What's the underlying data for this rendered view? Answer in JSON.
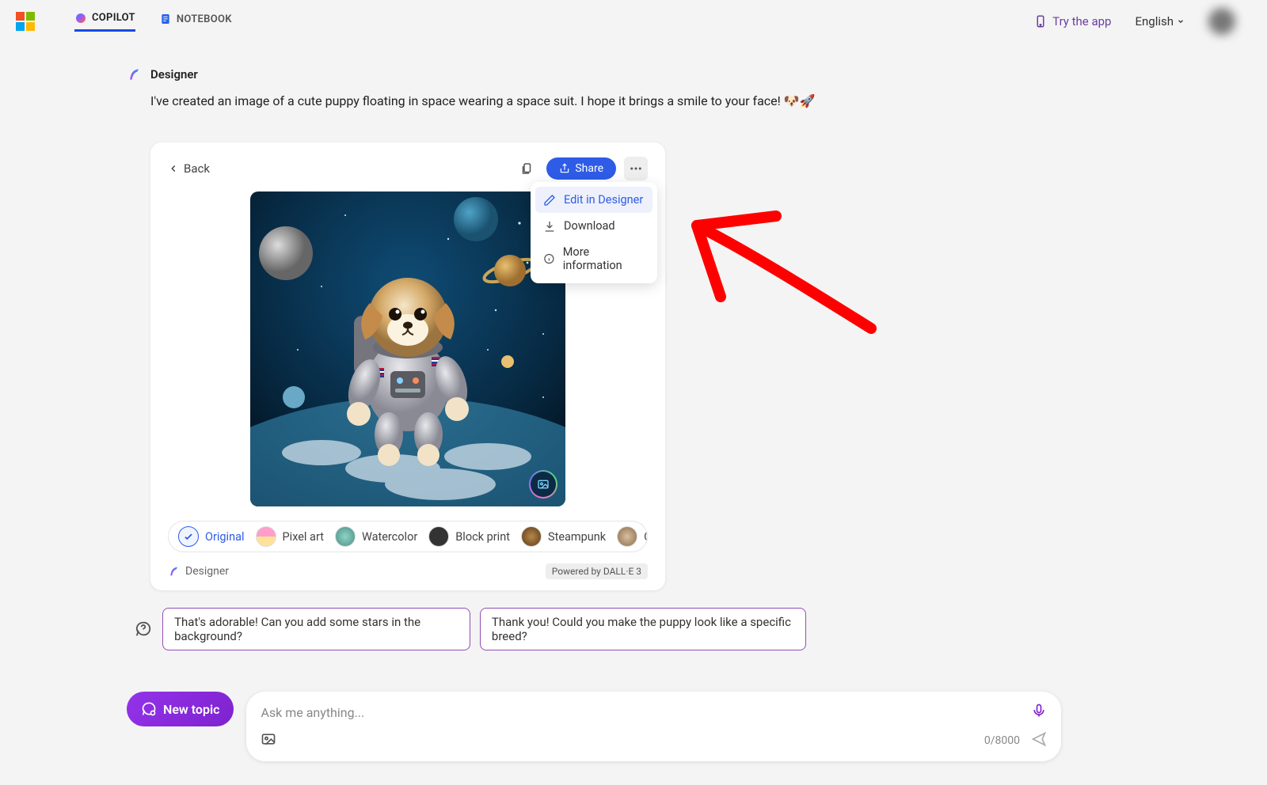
{
  "header": {
    "tabs": [
      {
        "label": "COPILOT",
        "active": true
      },
      {
        "label": "NOTEBOOK",
        "active": false
      }
    ],
    "try_app": "Try the app",
    "language": "English"
  },
  "assistant": {
    "name": "Designer",
    "message": "I've created an image of a cute puppy floating in space wearing a space suit. I hope it brings a smile to your face! 🐶🚀"
  },
  "card": {
    "back": "Back",
    "share": "Share",
    "menu": {
      "edit": "Edit in Designer",
      "download": "Download",
      "info": "More information"
    },
    "styles": [
      {
        "label": "Original",
        "selected": true
      },
      {
        "label": "Pixel art"
      },
      {
        "label": "Watercolor"
      },
      {
        "label": "Block print"
      },
      {
        "label": "Steampunk"
      },
      {
        "label": "Cl"
      }
    ],
    "footer_designer": "Designer",
    "powered_by": "Powered by DALL·E 3"
  },
  "suggestions": [
    "That's adorable! Can you add some stars in the background?",
    "Thank you! Could you make the puppy look like a specific breed?"
  ],
  "input": {
    "new_topic": "New topic",
    "placeholder": "Ask me anything...",
    "char_count": "0/8000"
  }
}
